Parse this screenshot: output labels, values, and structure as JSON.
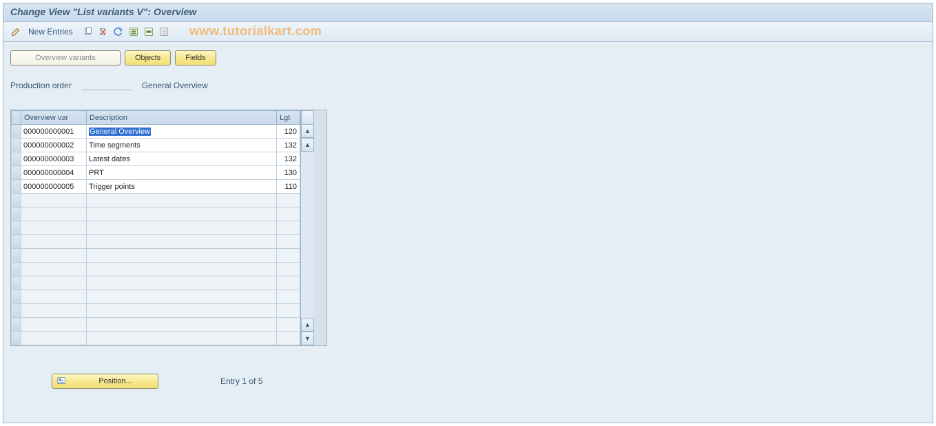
{
  "header": {
    "title": "Change View \"List variants                   V\": Overview"
  },
  "toolbar": {
    "new_entries_label": "New Entries"
  },
  "watermark": "www.tutorialkart.com",
  "nav": {
    "overview_variants": "Overview variants",
    "objects": "Objects",
    "fields": "Fields"
  },
  "fields": {
    "prod_order_label": "Production order",
    "prod_order_value": "",
    "general_overview_label": "General Overview"
  },
  "table": {
    "headers": {
      "overview_var": "Overview var",
      "description": "Description",
      "lgt": "Lgt"
    },
    "rows": [
      {
        "ov": "000000000001",
        "desc": "General Overview",
        "lgt": "120",
        "selected": true
      },
      {
        "ov": "000000000002",
        "desc": "Time segments",
        "lgt": "132"
      },
      {
        "ov": "000000000003",
        "desc": "Latest dates",
        "lgt": "132"
      },
      {
        "ov": "000000000004",
        "desc": "PRT",
        "lgt": "130"
      },
      {
        "ov": "000000000005",
        "desc": "Trigger points",
        "lgt": "110"
      }
    ],
    "empty_rows": 11
  },
  "footer": {
    "position_label": "Position...",
    "entry_text": "Entry 1 of 5"
  }
}
